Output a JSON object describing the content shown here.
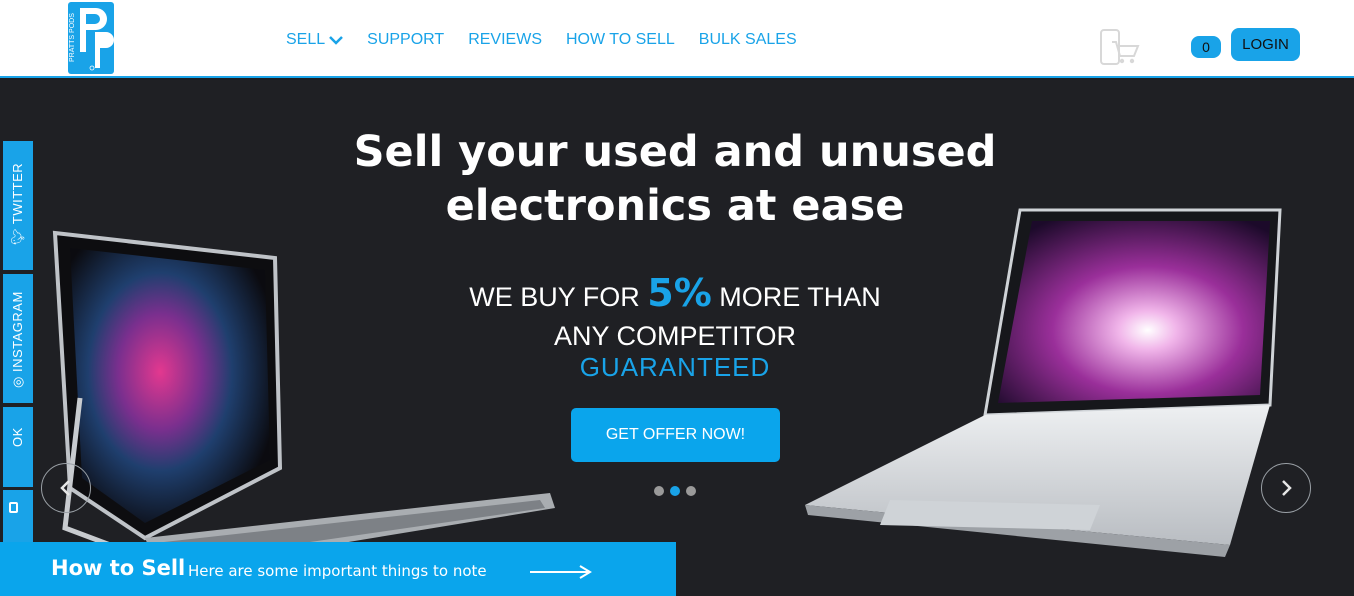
{
  "header": {
    "logo": {
      "text": "PRATTS PODS",
      "icon": "pratts-pods-logo"
    },
    "nav": [
      {
        "label": "SELL",
        "has_dropdown": true
      },
      {
        "label": "SUPPORT"
      },
      {
        "label": "REVIEWS"
      },
      {
        "label": "HOW TO SELL"
      },
      {
        "label": "BULK SALES"
      }
    ],
    "cart_icon": "phone-cart-icon",
    "cart_count": "0",
    "login_label": "LOGIN"
  },
  "hero": {
    "headline_line1": "Sell your used and unused",
    "headline_line2": "electronics at ease",
    "offer_prefix": "WE BUY FOR ",
    "offer_percent": "5%",
    "offer_suffix": " MORE THAN",
    "offer_line2": "ANY COMPETITOR",
    "offer_line3": "GUARANTEED",
    "cta_label": "GET OFFER NOW!",
    "slides": 3,
    "active_slide": 2
  },
  "social": [
    {
      "label": "TWITTER",
      "icon": "twitter-icon"
    },
    {
      "label": "INSTAGRAM",
      "icon": "instagram-icon"
    },
    {
      "label": "OK",
      "icon": ""
    },
    {
      "label": "",
      "icon": "square-icon"
    }
  ],
  "how_to_sell": {
    "title": "How to Sell",
    "subtitle": "Here are some important things to note"
  },
  "colors": {
    "accent": "#19a3e8",
    "hero_bg": "#1f2024",
    "banner": "#0aa5ec"
  }
}
